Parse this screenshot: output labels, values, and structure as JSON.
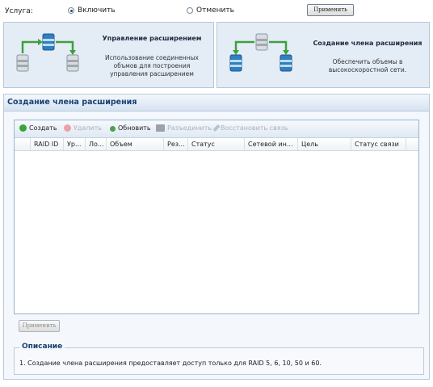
{
  "service": {
    "label": "Услуга:",
    "option_enable": "Включить",
    "option_cancel": "Отменить",
    "selected": "Включить",
    "apply_label": "Применить"
  },
  "cards": {
    "manage": {
      "title": "Управление расширением",
      "desc_line1": "Использование соединенных",
      "desc_line2": "объмов для построения",
      "desc_line3": "управления расширением"
    },
    "create": {
      "title": "Создание члена расширения",
      "desc_line1": "Обеспечить объемы в",
      "desc_line2": "высокоскоростной сети."
    }
  },
  "panel": {
    "title": "Создание члена расширения",
    "toolbar": {
      "create": "Создать",
      "delete": "Удалить",
      "refresh": "Обновить",
      "disconnect": "Разъединить",
      "restore": "Восстановить связь"
    },
    "columns": [
      "RAID ID",
      "Ур...",
      "Ло...",
      "Объем",
      "Рез...",
      "Статус",
      "Сетевой ин...",
      "Цель",
      "Статус связи"
    ],
    "apply_label": "Применить"
  },
  "description": {
    "legend": "Описание",
    "text": "1. Создание члена расширения предоставляет доступ только для RAID 5, 6, 10, 50 и 60."
  },
  "colors": {
    "accent": "#15406e",
    "card_bg": "#e4ecf6",
    "panel_border": "#b9c9dc"
  }
}
